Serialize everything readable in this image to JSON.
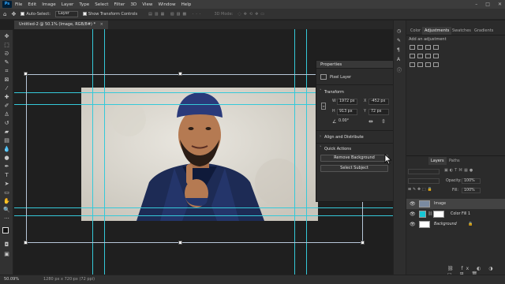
{
  "menu": {
    "logo": "Ps",
    "items": [
      "File",
      "Edit",
      "Image",
      "Layer",
      "Type",
      "Select",
      "Filter",
      "3D",
      "View",
      "Window",
      "Help"
    ],
    "window_controls": [
      "–",
      "□",
      "✕"
    ]
  },
  "options_bar": {
    "auto_select_label": "Auto-Select:",
    "auto_select_target": "Layer",
    "show_transform_label": "Show Transform Controls",
    "mode_label": "3D Mode:",
    "more": "..."
  },
  "document_tab": {
    "label": "Untitled-2 @ 50.1% (Image, RGB/8#) *",
    "close": "×"
  },
  "properties": {
    "title": "Properties",
    "layer_type": "Pixel Layer",
    "transform_title": "Transform",
    "w_label": "W",
    "w_value": "1972 px",
    "h_label": "H",
    "h_value": "913 px",
    "x_label": "X",
    "x_value": "-452 px",
    "y_label": "Y",
    "y_value": "72 px",
    "angle_value": "0.00°",
    "align_title": "Align and Distribute",
    "quick_actions_title": "Quick Actions",
    "remove_bg_label": "Remove Background",
    "select_subject_label": "Select Subject"
  },
  "right_panels": {
    "top_tabs": [
      "Color",
      "Adjustments",
      "Swatches",
      "Gradients"
    ],
    "active_top_tab": "Adjustments",
    "add_adjustment": "Add an adjustment",
    "layers_tabs": [
      "Layers",
      "Paths"
    ],
    "opacity_label": "Opacity:",
    "opacity_value": "100%",
    "fill_label": "Fill:",
    "fill_value": "100%",
    "layers": [
      {
        "name": "Image",
        "italic": false,
        "thumb": "#7a8aa0"
      },
      {
        "name": "Color Fill 1",
        "italic": false,
        "thumb": "#17c6d4"
      },
      {
        "name": "Background",
        "italic": true,
        "thumb": "#ffffff"
      }
    ]
  },
  "status": {
    "zoom": "50.09%",
    "info": "1280 px x 720 px (72 ppi)"
  },
  "colors": {
    "guide": "#35c9d9",
    "color_fill": "#17c6d4",
    "ps_blue": "#31a8ff"
  }
}
